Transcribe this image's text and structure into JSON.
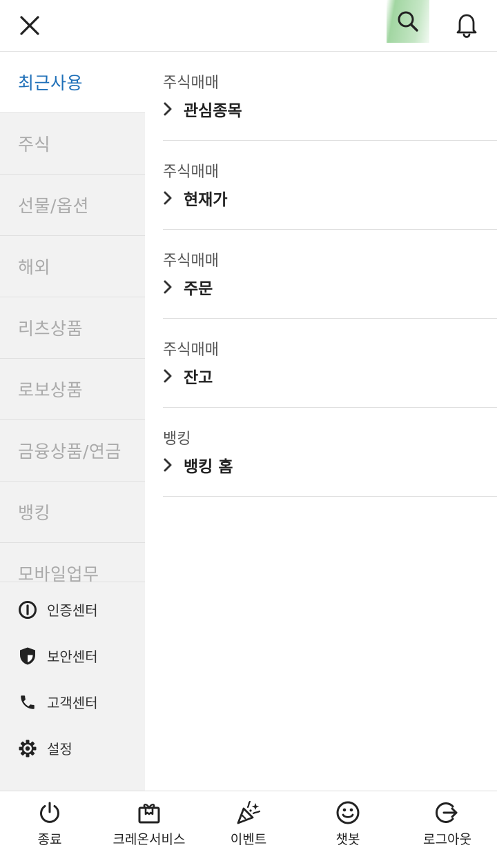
{
  "header": {
    "close_icon": "close-icon",
    "search_icon": "search-icon",
    "bell_icon": "bell-icon"
  },
  "sidebar": {
    "categories": [
      {
        "label": "최근사용",
        "active": true
      },
      {
        "label": "주식",
        "active": false
      },
      {
        "label": "선물/옵션",
        "active": false
      },
      {
        "label": "해외",
        "active": false
      },
      {
        "label": "리츠상품",
        "active": false
      },
      {
        "label": "로보상품",
        "active": false
      },
      {
        "label": "금융상품/연금",
        "active": false
      },
      {
        "label": "뱅킹",
        "active": false
      },
      {
        "label": "모바일업무",
        "active": false
      }
    ],
    "utilities": [
      {
        "label": "인증센터",
        "icon": "power-circle-icon"
      },
      {
        "label": "보안센터",
        "icon": "shield-icon"
      },
      {
        "label": "고객센터",
        "icon": "phone-icon"
      },
      {
        "label": "설정",
        "icon": "gear-icon"
      }
    ]
  },
  "recent": [
    {
      "category": "주식매매",
      "title": "관심종목"
    },
    {
      "category": "주식매매",
      "title": "현재가"
    },
    {
      "category": "주식매매",
      "title": "주문"
    },
    {
      "category": "주식매매",
      "title": "잔고"
    },
    {
      "category": "뱅킹",
      "title": "뱅킹 홈"
    }
  ],
  "bottom_nav": [
    {
      "label": "종료",
      "icon": "power-icon"
    },
    {
      "label": "크레온서비스",
      "icon": "gift-icon"
    },
    {
      "label": "이벤트",
      "icon": "party-icon"
    },
    {
      "label": "챗봇",
      "icon": "smiley-icon"
    },
    {
      "label": "로그아웃",
      "icon": "logout-icon"
    }
  ],
  "colors": {
    "accent": "#1e6fb8",
    "sidebar_bg": "#f2f2f2",
    "inactive_text": "#aaaaaa",
    "search_highlight": "#8ccd8c"
  }
}
